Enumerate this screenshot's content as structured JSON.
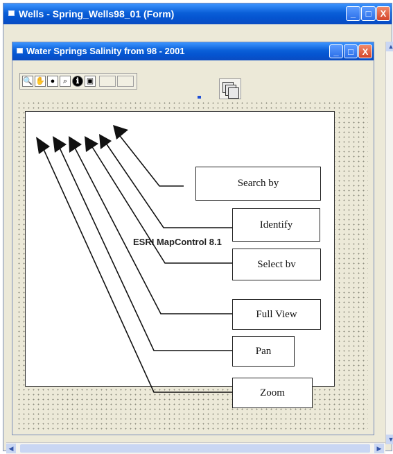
{
  "outer_window": {
    "title": "Wells - Spring_Wells98_01 (Form)",
    "controls": {
      "minimize": "_",
      "maximize": "□",
      "close": "X"
    }
  },
  "inner_window": {
    "title": "Water Springs Salinity from 98 - 2001",
    "controls": {
      "minimize": "_",
      "maximize": "□",
      "close": "X"
    }
  },
  "toolbar": {
    "buttons": [
      {
        "icon": "zoom-icon",
        "glyph": "🔍"
      },
      {
        "icon": "pan-icon",
        "glyph": "✋"
      },
      {
        "icon": "full-view-icon",
        "glyph": "●"
      },
      {
        "icon": "select-icon",
        "glyph": "⌕"
      },
      {
        "icon": "identify-icon",
        "glyph": "ℹ"
      },
      {
        "icon": "search-icon",
        "glyph": "▣"
      }
    ]
  },
  "map_control_label": "ESRI MapControl 8.1",
  "callouts": {
    "search_by": "Search by",
    "identify": "Identify",
    "select_by": "Select bv",
    "full_view": "Full View",
    "pan": "Pan",
    "zoom": "Zoom"
  },
  "colors": {
    "titlebar": "#0a5fd8",
    "window_bg": "#ece9d8",
    "close_button": "#d4442a"
  }
}
